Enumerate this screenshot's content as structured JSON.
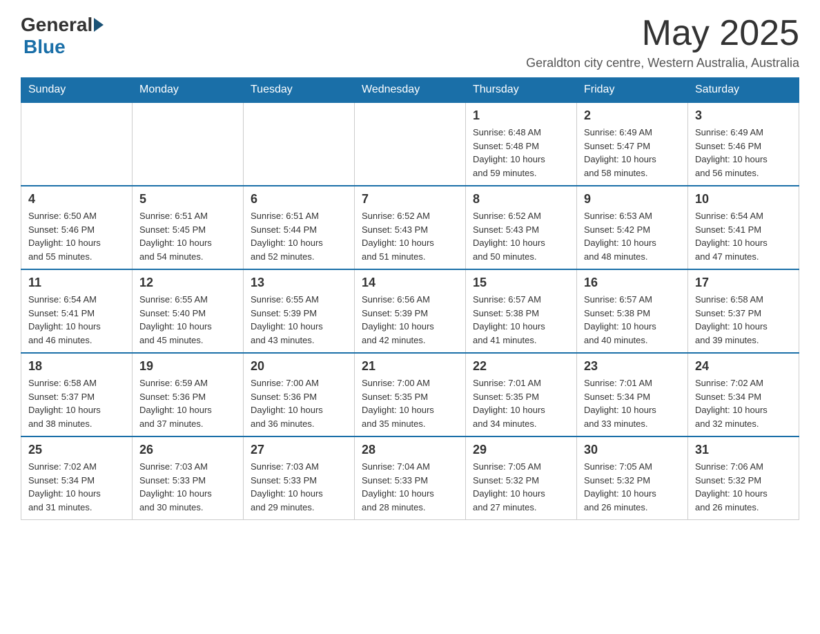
{
  "logo": {
    "text1": "General",
    "text2": "Blue"
  },
  "header": {
    "title": "May 2025",
    "subtitle": "Geraldton city centre, Western Australia, Australia"
  },
  "weekdays": [
    "Sunday",
    "Monday",
    "Tuesday",
    "Wednesday",
    "Thursday",
    "Friday",
    "Saturday"
  ],
  "weeks": [
    [
      {
        "day": "",
        "info": ""
      },
      {
        "day": "",
        "info": ""
      },
      {
        "day": "",
        "info": ""
      },
      {
        "day": "",
        "info": ""
      },
      {
        "day": "1",
        "info": "Sunrise: 6:48 AM\nSunset: 5:48 PM\nDaylight: 10 hours\nand 59 minutes."
      },
      {
        "day": "2",
        "info": "Sunrise: 6:49 AM\nSunset: 5:47 PM\nDaylight: 10 hours\nand 58 minutes."
      },
      {
        "day": "3",
        "info": "Sunrise: 6:49 AM\nSunset: 5:46 PM\nDaylight: 10 hours\nand 56 minutes."
      }
    ],
    [
      {
        "day": "4",
        "info": "Sunrise: 6:50 AM\nSunset: 5:46 PM\nDaylight: 10 hours\nand 55 minutes."
      },
      {
        "day": "5",
        "info": "Sunrise: 6:51 AM\nSunset: 5:45 PM\nDaylight: 10 hours\nand 54 minutes."
      },
      {
        "day": "6",
        "info": "Sunrise: 6:51 AM\nSunset: 5:44 PM\nDaylight: 10 hours\nand 52 minutes."
      },
      {
        "day": "7",
        "info": "Sunrise: 6:52 AM\nSunset: 5:43 PM\nDaylight: 10 hours\nand 51 minutes."
      },
      {
        "day": "8",
        "info": "Sunrise: 6:52 AM\nSunset: 5:43 PM\nDaylight: 10 hours\nand 50 minutes."
      },
      {
        "day": "9",
        "info": "Sunrise: 6:53 AM\nSunset: 5:42 PM\nDaylight: 10 hours\nand 48 minutes."
      },
      {
        "day": "10",
        "info": "Sunrise: 6:54 AM\nSunset: 5:41 PM\nDaylight: 10 hours\nand 47 minutes."
      }
    ],
    [
      {
        "day": "11",
        "info": "Sunrise: 6:54 AM\nSunset: 5:41 PM\nDaylight: 10 hours\nand 46 minutes."
      },
      {
        "day": "12",
        "info": "Sunrise: 6:55 AM\nSunset: 5:40 PM\nDaylight: 10 hours\nand 45 minutes."
      },
      {
        "day": "13",
        "info": "Sunrise: 6:55 AM\nSunset: 5:39 PM\nDaylight: 10 hours\nand 43 minutes."
      },
      {
        "day": "14",
        "info": "Sunrise: 6:56 AM\nSunset: 5:39 PM\nDaylight: 10 hours\nand 42 minutes."
      },
      {
        "day": "15",
        "info": "Sunrise: 6:57 AM\nSunset: 5:38 PM\nDaylight: 10 hours\nand 41 minutes."
      },
      {
        "day": "16",
        "info": "Sunrise: 6:57 AM\nSunset: 5:38 PM\nDaylight: 10 hours\nand 40 minutes."
      },
      {
        "day": "17",
        "info": "Sunrise: 6:58 AM\nSunset: 5:37 PM\nDaylight: 10 hours\nand 39 minutes."
      }
    ],
    [
      {
        "day": "18",
        "info": "Sunrise: 6:58 AM\nSunset: 5:37 PM\nDaylight: 10 hours\nand 38 minutes."
      },
      {
        "day": "19",
        "info": "Sunrise: 6:59 AM\nSunset: 5:36 PM\nDaylight: 10 hours\nand 37 minutes."
      },
      {
        "day": "20",
        "info": "Sunrise: 7:00 AM\nSunset: 5:36 PM\nDaylight: 10 hours\nand 36 minutes."
      },
      {
        "day": "21",
        "info": "Sunrise: 7:00 AM\nSunset: 5:35 PM\nDaylight: 10 hours\nand 35 minutes."
      },
      {
        "day": "22",
        "info": "Sunrise: 7:01 AM\nSunset: 5:35 PM\nDaylight: 10 hours\nand 34 minutes."
      },
      {
        "day": "23",
        "info": "Sunrise: 7:01 AM\nSunset: 5:34 PM\nDaylight: 10 hours\nand 33 minutes."
      },
      {
        "day": "24",
        "info": "Sunrise: 7:02 AM\nSunset: 5:34 PM\nDaylight: 10 hours\nand 32 minutes."
      }
    ],
    [
      {
        "day": "25",
        "info": "Sunrise: 7:02 AM\nSunset: 5:34 PM\nDaylight: 10 hours\nand 31 minutes."
      },
      {
        "day": "26",
        "info": "Sunrise: 7:03 AM\nSunset: 5:33 PM\nDaylight: 10 hours\nand 30 minutes."
      },
      {
        "day": "27",
        "info": "Sunrise: 7:03 AM\nSunset: 5:33 PM\nDaylight: 10 hours\nand 29 minutes."
      },
      {
        "day": "28",
        "info": "Sunrise: 7:04 AM\nSunset: 5:33 PM\nDaylight: 10 hours\nand 28 minutes."
      },
      {
        "day": "29",
        "info": "Sunrise: 7:05 AM\nSunset: 5:32 PM\nDaylight: 10 hours\nand 27 minutes."
      },
      {
        "day": "30",
        "info": "Sunrise: 7:05 AM\nSunset: 5:32 PM\nDaylight: 10 hours\nand 26 minutes."
      },
      {
        "day": "31",
        "info": "Sunrise: 7:06 AM\nSunset: 5:32 PM\nDaylight: 10 hours\nand 26 minutes."
      }
    ]
  ]
}
